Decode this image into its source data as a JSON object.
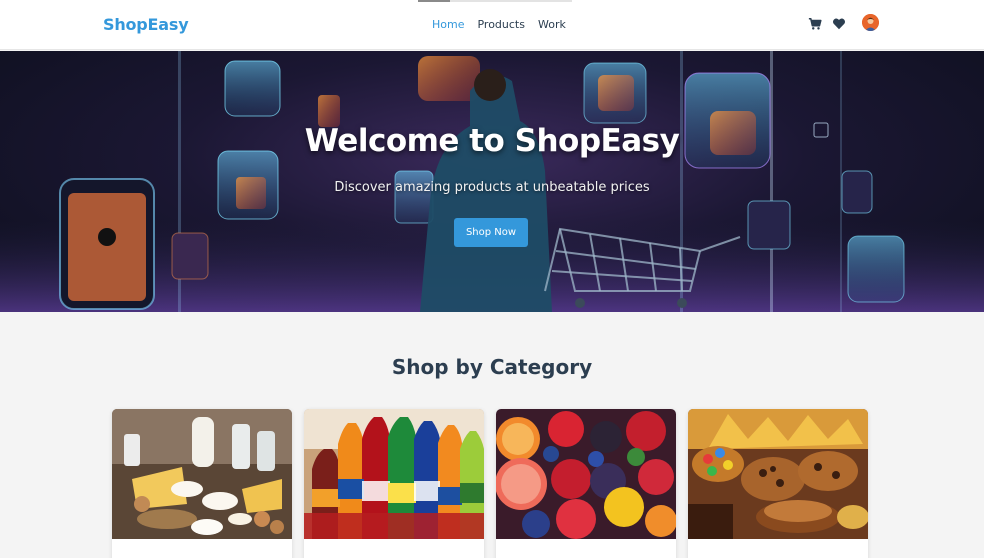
{
  "header": {
    "brand": "ShopEasy",
    "nav": [
      "Home",
      "Products",
      "Work"
    ],
    "active_nav": "Home",
    "icons": [
      "cart-icon",
      "heart-icon",
      "avatar"
    ]
  },
  "hero": {
    "title": "Welcome to ShopEasy",
    "subtitle": "Discover amazing products at unbeatable prices",
    "cta_label": "Shop Now"
  },
  "categories": {
    "title": "Shop by Category",
    "items": [
      {
        "image": "dairy-products-image"
      },
      {
        "image": "soft-drinks-image"
      },
      {
        "image": "fruits-image"
      },
      {
        "image": "snacks-sweets-image"
      }
    ]
  },
  "colors": {
    "accent": "#3498db",
    "text": "#2c3e50",
    "background": "#f4f4f4"
  }
}
